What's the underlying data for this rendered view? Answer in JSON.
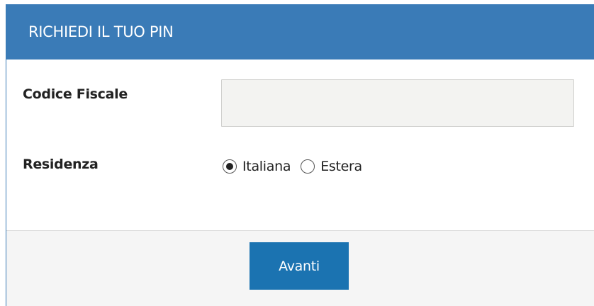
{
  "header": {
    "title": "RICHIEDI IL TUO PIN"
  },
  "form": {
    "codice_fiscale": {
      "label": "Codice Fiscale",
      "value": "",
      "placeholder": ""
    },
    "residenza": {
      "label": "Residenza",
      "options": [
        {
          "label": "Italiana",
          "checked": true
        },
        {
          "label": "Estera",
          "checked": false
        }
      ]
    }
  },
  "footer": {
    "submit_label": "Avanti"
  },
  "colors": {
    "header_bg": "#3a7bb7",
    "button_bg": "#1b73b1",
    "input_bg": "#f3f3f1",
    "footer_bg": "#f5f5f5"
  }
}
